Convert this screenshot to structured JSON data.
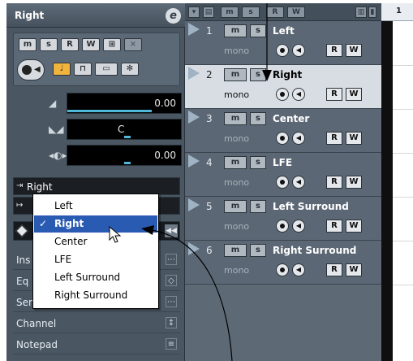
{
  "inspector": {
    "track_name": "Right",
    "edit_icon_label": "e",
    "buttons_row1": [
      "m",
      "s",
      "R",
      "W",
      "⊞",
      "⨯"
    ],
    "meters": {
      "volume": "0.00",
      "pan": "C",
      "delay": "0.00"
    },
    "input_routing": "Right",
    "sections": [
      {
        "label": "Ins",
        "icon": "⋯"
      },
      {
        "label": "Eq",
        "icon": "◇"
      },
      {
        "label": "Sends",
        "icon": "⋯"
      },
      {
        "label": "Channel",
        "icon": "↕"
      },
      {
        "label": "Notepad",
        "icon": "≡"
      }
    ]
  },
  "dropdown": {
    "items": [
      {
        "label": "Left",
        "checked": false
      },
      {
        "label": "Right",
        "checked": true
      },
      {
        "label": "Center",
        "checked": false
      },
      {
        "label": "LFE",
        "checked": false
      },
      {
        "label": "Left Surround",
        "checked": false
      },
      {
        "label": "Right Surround",
        "checked": false
      }
    ],
    "check_glyph": "✓"
  },
  "tracks": [
    {
      "num": "1",
      "name": "Left",
      "mode": "mono",
      "selected": false
    },
    {
      "num": "2",
      "name": "Right",
      "mode": "mono",
      "selected": true
    },
    {
      "num": "3",
      "name": "Center",
      "mode": "mono",
      "selected": false
    },
    {
      "num": "4",
      "name": "LFE",
      "mode": "mono",
      "selected": false
    },
    {
      "num": "5",
      "name": "Left Surround",
      "mode": "mono",
      "selected": false
    },
    {
      "num": "6",
      "name": "Right Surround",
      "mode": "mono",
      "selected": false
    }
  ],
  "track_buttons": {
    "m": "m",
    "s": "s",
    "r": "R",
    "w": "W"
  },
  "toolbar_labels": [
    "m",
    "s",
    "R",
    "W"
  ],
  "ruler_label": "1",
  "colors": {
    "inspector_bg": "#4a5763",
    "track_bg": "#5b6774",
    "selected_track_bg": "#d7dde3",
    "menu_selected": "#2a5bb3",
    "accent_note": "#f0b43c"
  }
}
